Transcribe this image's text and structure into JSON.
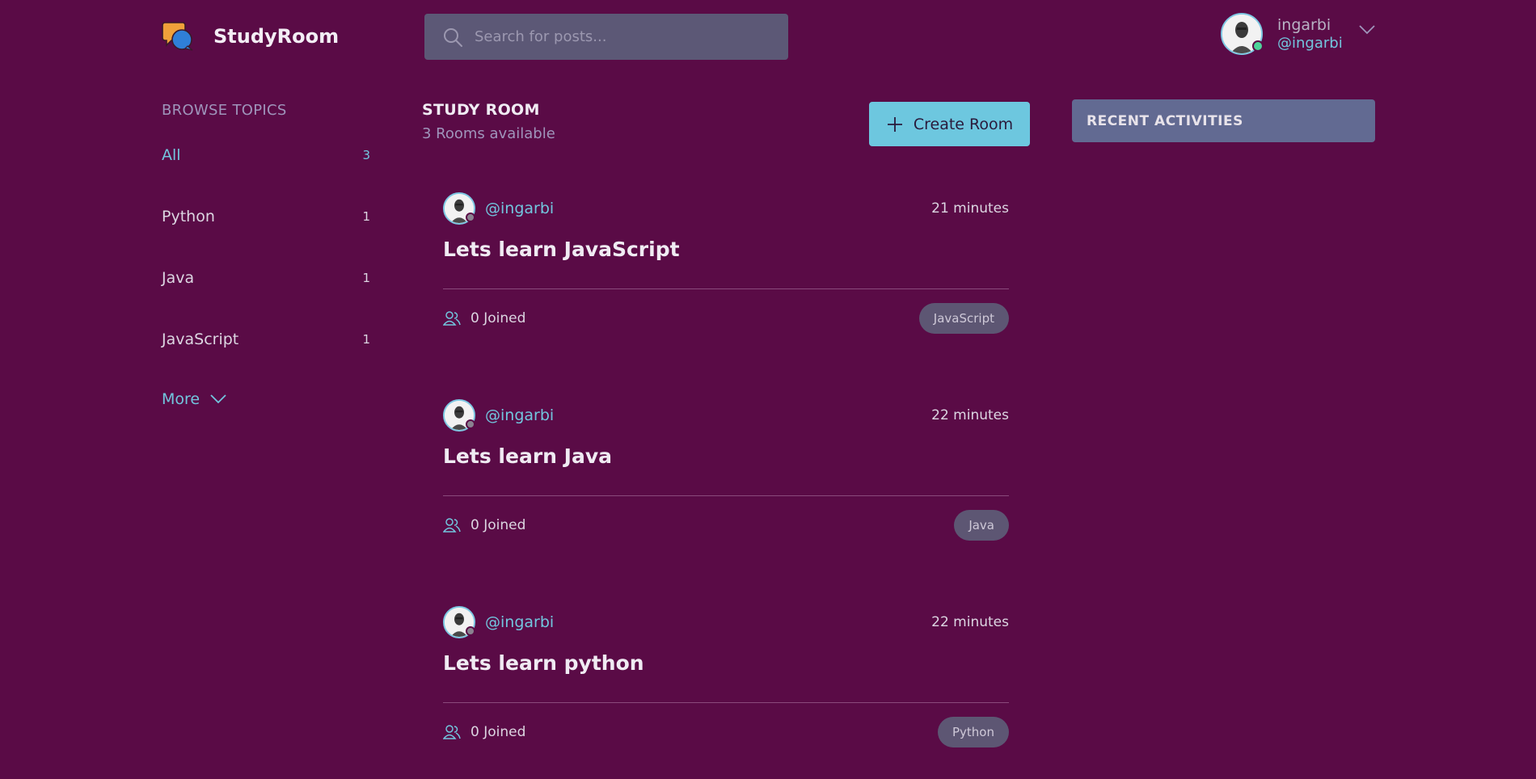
{
  "app": {
    "name": "StudyRoom"
  },
  "search": {
    "placeholder": "Search for posts..."
  },
  "user": {
    "name": "ingarbi",
    "handle": "@ingarbi"
  },
  "sidebar": {
    "title": "BROWSE TOPICS",
    "topics": [
      {
        "name": "All",
        "count": "3",
        "active": true
      },
      {
        "name": "Python",
        "count": "1"
      },
      {
        "name": "Java",
        "count": "1"
      },
      {
        "name": "JavaScript",
        "count": "1"
      }
    ],
    "more_label": "More"
  },
  "main": {
    "title": "STUDY ROOM",
    "subtitle": "3 Rooms available",
    "create_label": "Create Room",
    "rooms": [
      {
        "author": "@ingarbi",
        "time": "21 minutes",
        "title": "Lets learn JavaScript",
        "joined": "0 Joined",
        "topic": "JavaScript"
      },
      {
        "author": "@ingarbi",
        "time": "22 minutes",
        "title": "Lets learn Java",
        "joined": "0 Joined",
        "topic": "Java"
      },
      {
        "author": "@ingarbi",
        "time": "22 minutes",
        "title": "Lets learn python",
        "joined": "0 Joined",
        "topic": "Python"
      }
    ]
  },
  "activities": {
    "title": "RECENT ACTIVITIES"
  },
  "colors": {
    "background": "#5a0b46",
    "accent": "#6dc7df",
    "online": "#4fd39a",
    "offline": "#8a8290"
  }
}
